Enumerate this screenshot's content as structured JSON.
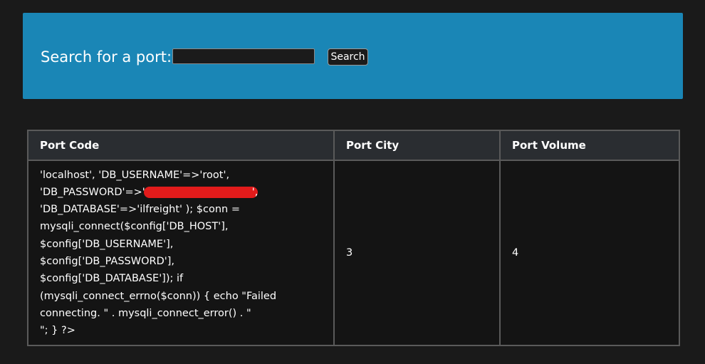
{
  "search": {
    "label": "Search for a port:",
    "input_value": "",
    "button_label": "Search"
  },
  "table": {
    "headers": [
      "Port Code",
      "Port City",
      "Port Volume"
    ],
    "rows": [
      {
        "code_lines": [
          "'localhost', 'DB_USERNAME'=>'root',",
          "'DB_PASSWORD'=>'",
          "',",
          "'DB_DATABASE'=>'ilfreight' ); $conn =",
          "mysqli_connect($config['DB_HOST'],",
          "$config['DB_USERNAME'],",
          "$config['DB_PASSWORD'],",
          "$config['DB_DATABASE']); if",
          "(mysqli_connect_errno($conn)) { echo \"Failed",
          "connecting. \" . mysqli_connect_error() . \"",
          "\"; } ?>"
        ],
        "city": "3",
        "volume": "4"
      }
    ]
  },
  "colors": {
    "background": "#1a1a1a",
    "search_panel": "#1a86b6",
    "redaction": "#e21b1b"
  }
}
